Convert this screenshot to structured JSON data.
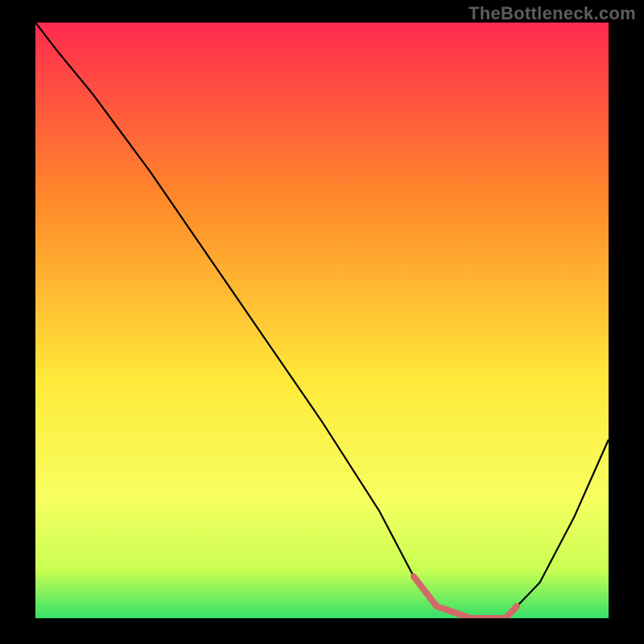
{
  "watermark": "TheBottleneck.com",
  "colors": {
    "background": "#000000",
    "curve_stroke": "#000000",
    "bottom_segment_stroke": "#d26a68",
    "gradient_top": "#ff2b4f",
    "gradient_mid_upper": "#ff8a2a",
    "gradient_mid": "#ffe93a",
    "gradient_lower": "#f7ff61",
    "gradient_near_bottom": "#c8ff52",
    "gradient_bottom": "#35e06a"
  },
  "chart_data": {
    "type": "line",
    "title": "",
    "xlabel": "",
    "ylabel": "",
    "xlim": [
      0,
      100
    ],
    "ylim": [
      0,
      100
    ],
    "series": [
      {
        "name": "curve",
        "x": [
          0,
          4,
          10,
          20,
          30,
          40,
          50,
          60,
          66,
          70,
          76,
          82,
          88,
          94,
          100
        ],
        "y": [
          100,
          95,
          88,
          75,
          61,
          47,
          33,
          18,
          7,
          2,
          0,
          0,
          6,
          17,
          30
        ]
      }
    ],
    "highlight_segment": {
      "note": "thicker red-pink segment near the valley bottom",
      "x": [
        66,
        70,
        76,
        82,
        84
      ],
      "y": [
        7,
        2,
        0,
        0,
        2
      ]
    }
  }
}
